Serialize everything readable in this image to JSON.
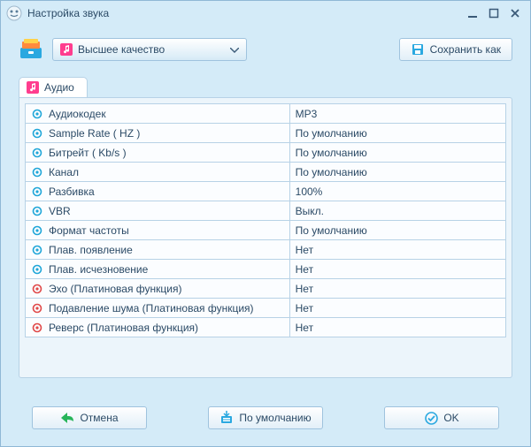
{
  "window": {
    "title": "Настройка звука"
  },
  "toolbar": {
    "quality_label": "Высшее качество",
    "save_as_label": "Сохранить как"
  },
  "audio_tab_label": "Аудио",
  "rows": [
    {
      "icon": "codec-icon",
      "color": "#1fa6d8",
      "label": "Аудиокодек",
      "value": "MP3"
    },
    {
      "icon": "rate-icon",
      "color": "#1fa6d8",
      "label": "Sample Rate ( HZ )",
      "value": "По умолчанию"
    },
    {
      "icon": "bitrate-icon",
      "color": "#1fa6d8",
      "label": "Битрейт ( Kb/s )",
      "value": "По умолчанию"
    },
    {
      "icon": "channel-icon",
      "color": "#1fa6d8",
      "label": "Канал",
      "value": "По умолчанию"
    },
    {
      "icon": "volume-icon",
      "color": "#1fa6d8",
      "label": "Разбивка",
      "value": "100%"
    },
    {
      "icon": "vbr-icon",
      "color": "#1fa6d8",
      "label": "VBR",
      "value": "Выкл."
    },
    {
      "icon": "format-icon",
      "color": "#1fa6d8",
      "label": "Формат частоты",
      "value": "По умолчанию"
    },
    {
      "icon": "fadein-icon",
      "color": "#1fa6d8",
      "label": "Плав. появление",
      "value": "Нет"
    },
    {
      "icon": "fadeout-icon",
      "color": "#1fa6d8",
      "label": "Плав. исчезновение",
      "value": "Нет"
    },
    {
      "icon": "echo-icon",
      "color": "#e04848",
      "label": "Эхо (Платиновая функция)",
      "value": "Нет"
    },
    {
      "icon": "denoise-icon",
      "color": "#e04848",
      "label": "Подавление шума (Платиновая функция)",
      "value": "Нет"
    },
    {
      "icon": "reverse-icon",
      "color": "#e04848",
      "label": "Реверс (Платиновая функция)",
      "value": "Нет"
    }
  ],
  "buttons": {
    "cancel": "Отмена",
    "default": "По умолчанию",
    "ok": "OK"
  }
}
